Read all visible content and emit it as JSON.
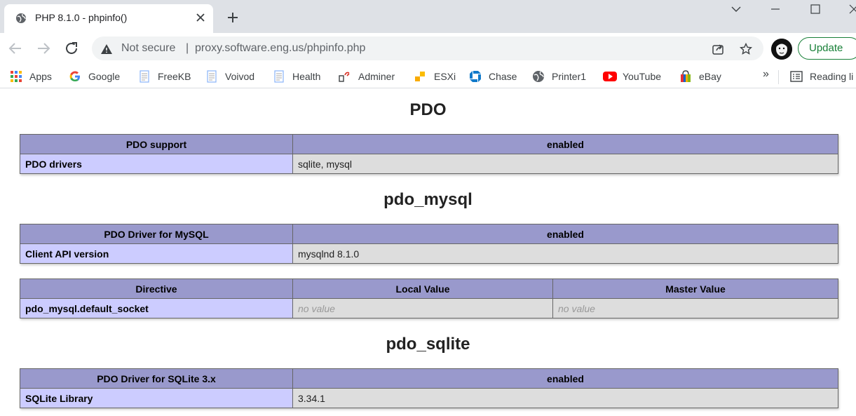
{
  "browser": {
    "tab_title": "PHP 8.1.0 - phpinfo()",
    "omnibox": {
      "security_label": "Not secure",
      "separator": "|",
      "url": "proxy.software.eng.us/phpinfo.php"
    },
    "update_label": "Update",
    "bookmarks": [
      {
        "label": "Apps",
        "icon": "apps-grid-icon"
      },
      {
        "label": "Google",
        "icon": "google-icon"
      },
      {
        "label": "FreeKB",
        "icon": "page-icon"
      },
      {
        "label": "Voivod",
        "icon": "page-icon"
      },
      {
        "label": "Health",
        "icon": "page-icon"
      },
      {
        "label": "Adminer",
        "icon": "adminer-icon"
      },
      {
        "label": "ESXi",
        "icon": "esxi-icon"
      },
      {
        "label": "Chase",
        "icon": "chase-icon"
      },
      {
        "label": "Printer1",
        "icon": "globe-icon"
      },
      {
        "label": "YouTube",
        "icon": "youtube-icon"
      },
      {
        "label": "eBay",
        "icon": "ebay-icon"
      }
    ],
    "more_label": "»",
    "reading_list_label": "Reading li"
  },
  "page": {
    "sections": [
      {
        "title": "PDO",
        "tables": [
          {
            "header": [
              "PDO support",
              "enabled"
            ],
            "rows": [
              [
                "PDO drivers",
                "sqlite, mysql"
              ]
            ]
          }
        ]
      },
      {
        "title": "pdo_mysql",
        "tables": [
          {
            "header": [
              "PDO Driver for MySQL",
              "enabled"
            ],
            "rows": [
              [
                "Client API version",
                "mysqlnd 8.1.0"
              ]
            ]
          },
          {
            "header": [
              "Directive",
              "Local Value",
              "Master Value"
            ],
            "rows": [
              [
                "pdo_mysql.default_socket",
                "no value",
                "no value"
              ]
            ]
          }
        ]
      },
      {
        "title": "pdo_sqlite",
        "tables": [
          {
            "header": [
              "PDO Driver for SQLite 3.x",
              "enabled"
            ],
            "rows": [
              [
                "SQLite Library",
                "3.34.1"
              ]
            ]
          }
        ]
      }
    ]
  },
  "colors": {
    "header_bg": "#9999cc",
    "key_bg": "#ccccff",
    "value_bg": "#dddddd"
  }
}
